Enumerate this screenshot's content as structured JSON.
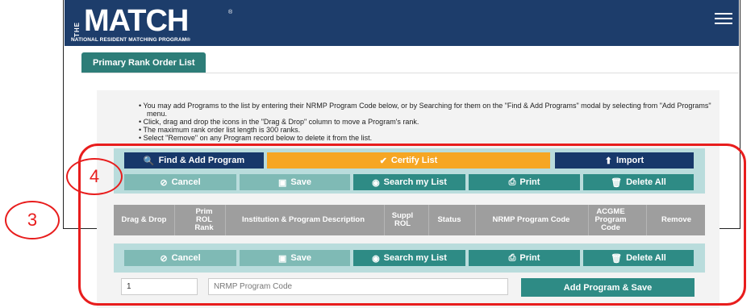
{
  "header": {
    "logo_vertical": "THE",
    "logo_word": "MATCH",
    "logo_reg": "®",
    "logo_subtitle": "NATIONAL RESIDENT MATCHING PROGRAM®",
    "menu_icon": "hamburger-icon"
  },
  "tab": {
    "label": "Primary Rank Order List"
  },
  "instructions": [
    "You may add Programs to the list by entering their NRMP Program Code below, or by Searching for them on the \"Find & Add Programs\" modal by selecting from \"Add Programs\" menu.",
    "Click, drag and drop the icons in the \"Drag & Drop\" column to move a Program's rank.",
    "The maximum rank order list length is 300 ranks.",
    "Select \"Remove\" on any Program record below to delete it from the list."
  ],
  "top_toolbar": {
    "find_add": {
      "label": "Find & Add Program",
      "icon": "search-plus-icon"
    },
    "certify": {
      "label": "Certify List",
      "icon": "check-icon"
    },
    "import": {
      "label": "Import",
      "icon": "upload-icon"
    },
    "cancel": {
      "label": "Cancel",
      "icon": "cancel-circle-icon"
    },
    "save": {
      "label": "Save",
      "icon": "floppy-icon"
    },
    "search": {
      "label": "Search my List",
      "icon": "binoculars-icon"
    },
    "print": {
      "label": "Print",
      "icon": "print-icon"
    },
    "delete_all": {
      "label": "Delete All",
      "icon": "trash-icon"
    }
  },
  "table": {
    "columns": [
      "Drag & Drop",
      "Prim ROL Rank",
      "Institution & Program Description",
      "Suppl ROL",
      "Status",
      "NRMP Program Code",
      "ACGME Program Code",
      "Remove"
    ]
  },
  "bottom_toolbar": {
    "cancel": {
      "label": "Cancel"
    },
    "save": {
      "label": "Save"
    },
    "search": {
      "label": "Search my List"
    },
    "print": {
      "label": "Print"
    },
    "delete_all": {
      "label": "Delete All"
    }
  },
  "add_row": {
    "rank_value": "1",
    "code_placeholder": "NRMP Program Code",
    "add_button": "Add Program & Save"
  },
  "callouts": {
    "three": "3",
    "four": "4"
  },
  "colors": {
    "header": "#1d3d6b",
    "tab": "#2d7d78",
    "certify": "#f6a623",
    "annotation": "#e81d1d"
  }
}
